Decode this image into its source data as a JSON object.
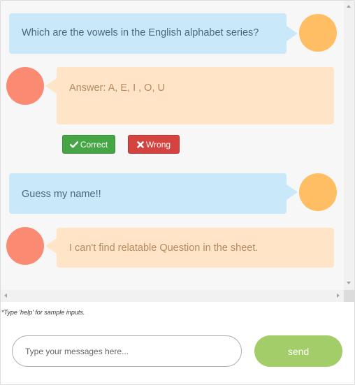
{
  "messages": [
    {
      "from": "user",
      "text": "Which are the vowels in the English alphabet series?"
    },
    {
      "from": "bot",
      "text": "Answer: A, E, I , O, U"
    },
    {
      "from": "user",
      "text": "Guess my name!!"
    },
    {
      "from": "bot",
      "text": "I can't find relatable Question in the sheet."
    }
  ],
  "feedback": {
    "correct_label": "Correct",
    "correct_icon": "check-icon",
    "wrong_label": "Wrong",
    "wrong_icon": "times-icon"
  },
  "help_text": "*Type 'help' for sample inputs.",
  "composer": {
    "placeholder": "Type your messages here...",
    "send_label": "send"
  },
  "colors": {
    "user_bubble": "#c9e9fb",
    "bot_bubble": "#ffe4c8",
    "user_avatar": "#ffbe64",
    "bot_avatar": "#fa8a72",
    "correct": "#46a545",
    "wrong": "#d54340",
    "send": "#a3cd68"
  }
}
